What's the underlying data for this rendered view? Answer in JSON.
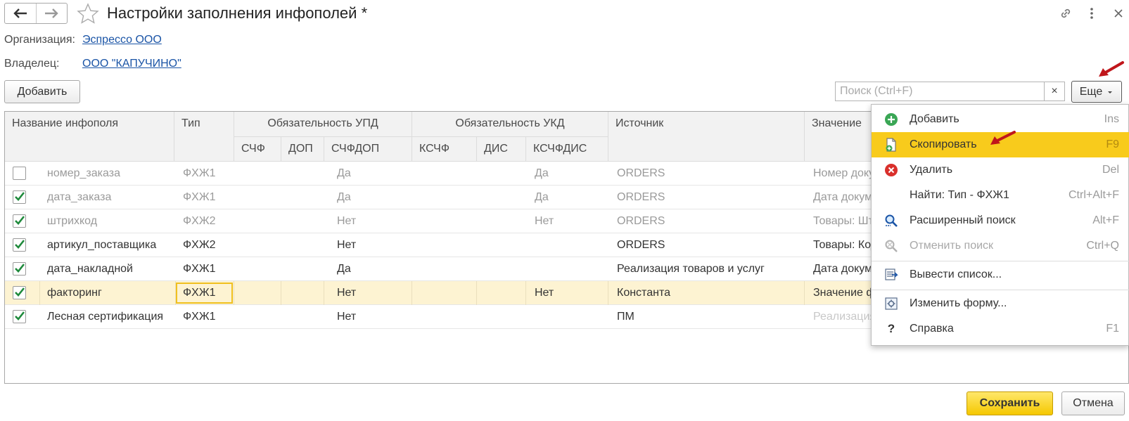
{
  "window": {
    "title": "Настройки заполнения инфополей *"
  },
  "header": {
    "org_label": "Организация:",
    "org_value": "Эспрессо ООО",
    "owner_label": "Владелец:",
    "owner_value": "ООО \"КАПУЧИНО\""
  },
  "toolbar": {
    "add_label": "Добавить",
    "search_placeholder": "Поиск (Ctrl+F)",
    "clear_glyph": "×",
    "more_label": "Еще"
  },
  "table": {
    "headers": {
      "name": "Название инфополя",
      "type": "Тип",
      "upd_group": "Обязательность УПД",
      "ukd_group": "Обязательность УКД",
      "source": "Источник",
      "value": "Значение",
      "sf": "СЧФ",
      "dop": "ДОП",
      "sfdop": "СЧФДОП",
      "ksf": "КСЧФ",
      "dis": "ДИС",
      "ksfdis": "КСЧФДИС"
    },
    "rows": [
      {
        "checked": false,
        "name": "номер_заказа",
        "type": "ФХЖ1",
        "sfdop": "Да",
        "ksfdis": "Да",
        "source": "ORDERS",
        "value": "Номер доку"
      },
      {
        "checked": true,
        "name": "дата_заказа",
        "type": "ФХЖ1",
        "sfdop": "Да",
        "ksfdis": "Да",
        "source": "ORDERS",
        "value": "Дата докум"
      },
      {
        "checked": true,
        "name": "штрихкод",
        "type": "ФХЖ2",
        "sfdop": "Нет",
        "ksfdis": "Нет",
        "source": "ORDERS",
        "value": "Товары: Шт"
      },
      {
        "checked": true,
        "name": "артикул_поставщика",
        "type": "ФХЖ2",
        "sfdop": "Нет",
        "ksfdis": "",
        "source": "ORDERS",
        "value": "Товары: Код"
      },
      {
        "checked": true,
        "name": "дата_накладной",
        "type": "ФХЖ1",
        "sfdop": "Да",
        "ksfdis": "",
        "source": "Реализация товаров и услуг",
        "value": "Дата докум"
      },
      {
        "checked": true,
        "name": "факторинг",
        "type": "ФХЖ1",
        "sfdop": "Нет",
        "ksfdis": "Нет",
        "source": "Константа",
        "value": "Значение ф"
      },
      {
        "checked": true,
        "name": "Лесная сертификация",
        "type": "ФХЖ1",
        "sfdop": "Нет",
        "ksfdis": "",
        "source": "ПМ",
        "value": "Реализация"
      }
    ]
  },
  "menu": {
    "items": [
      {
        "label": "Добавить",
        "shortcut": "Ins",
        "icon": "plus-circle-icon"
      },
      {
        "label": "Скопировать",
        "shortcut": "F9",
        "icon": "copy-document-icon"
      },
      {
        "label": "Удалить",
        "shortcut": "Del",
        "icon": "delete-circle-icon"
      },
      {
        "label": "Найти: Тип - ФХЖ1",
        "shortcut": "Ctrl+Alt+F",
        "icon": ""
      },
      {
        "label": "Расширенный поиск",
        "shortcut": "Alt+F",
        "icon": "magnifier-icon"
      },
      {
        "label": "Отменить поиск",
        "shortcut": "Ctrl+Q",
        "icon": "cancel-search-icon"
      },
      {
        "label": "Вывести список...",
        "shortcut": "",
        "icon": "output-list-icon"
      },
      {
        "label": "Изменить форму...",
        "shortcut": "",
        "icon": "form-settings-icon"
      },
      {
        "label": "Справка",
        "shortcut": "F1",
        "icon": "question-icon"
      }
    ]
  },
  "footer": {
    "save_label": "Сохранить",
    "cancel_label": "Отмена"
  },
  "colors": {
    "highlight": "#f8cb1c",
    "link": "#1a54a6",
    "check": "#1f8a3c",
    "arrow": "#c0161b"
  }
}
